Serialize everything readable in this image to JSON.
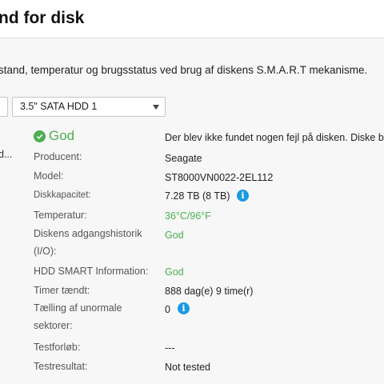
{
  "header": {
    "title": "nd for disk"
  },
  "description": "stand, temperatur og brugsstatus ved brug af diskens S.M.A.R.T mekanisme.",
  "disk_select": {
    "value": "3.5\" SATA HDD 1"
  },
  "left_truncated": "d...",
  "status": {
    "label": "God",
    "message": "Der blev ikke fundet nogen fejl på disken. Diske bu"
  },
  "fields": {
    "manufacturer": {
      "label": "Producent:",
      "value": "Seagate"
    },
    "model": {
      "label": "Model:",
      "value": "ST8000VN0022-2EL112"
    },
    "capacity": {
      "label": "Diskkapacitet:",
      "value": "7.28 TB (8 TB)"
    },
    "temperature": {
      "label": "Temperatur:",
      "value": "36°C/96°F"
    },
    "access_history": {
      "label": "Diskens adgangshistorik (I/O):",
      "value": "God"
    },
    "smart_info": {
      "label": "HDD SMART Information:",
      "value": "God"
    },
    "power_on": {
      "label": "Timer tændt:",
      "value": "888 dag(e) 9 time(r)"
    },
    "abnormal_sectors": {
      "label": "Tælling af unormale sektorer:",
      "value": "0"
    },
    "test_progress": {
      "label": "Testforløb:",
      "value": "---"
    },
    "test_result": {
      "label": "Testresultat:",
      "value": "Not tested"
    }
  },
  "colors": {
    "accent_green": "#4caf50",
    "info_blue": "#1a9ae0"
  }
}
